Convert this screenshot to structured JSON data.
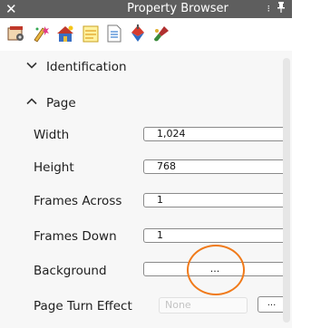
{
  "window": {
    "title": "Property Browser",
    "close_glyph": "✕",
    "float_glyph": "⁝",
    "pin_glyph": "🖈"
  },
  "toolbar": {
    "icons": [
      "page-setup-icon",
      "sparkle-paint-icon",
      "house-scene-icon",
      "notepad-icon",
      "document-list-icon",
      "diamond-pen-icon",
      "paint-brush-icon"
    ]
  },
  "sections": {
    "identification": {
      "label": "Identification",
      "expanded": false
    },
    "page": {
      "label": "Page",
      "expanded": true
    }
  },
  "properties": {
    "width": {
      "label": "Width",
      "value": "1,024"
    },
    "height": {
      "label": "Height",
      "value": "768"
    },
    "frames_across": {
      "label": "Frames Across",
      "value": "1"
    },
    "frames_down": {
      "label": "Frames Down",
      "value": "1"
    },
    "background": {
      "label": "Background",
      "button": "..."
    },
    "page_turn_effect": {
      "label": "Page Turn Effect",
      "value": "None",
      "button": "..."
    }
  },
  "colors": {
    "titlebar": "#5e5e5e",
    "annotation_circle": "#f07a1a"
  }
}
